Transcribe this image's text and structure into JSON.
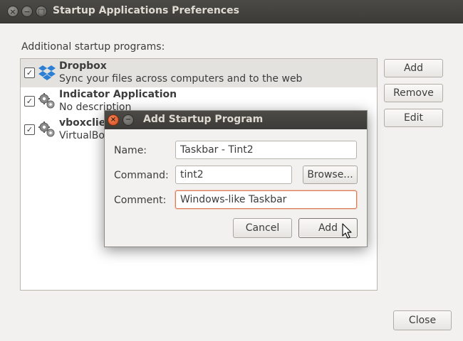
{
  "window": {
    "title": "Startup Applications Preferences",
    "close_glyph": "×",
    "min_glyph": "−",
    "max_glyph": "□"
  },
  "list_label": "Additional startup programs:",
  "programs": [
    {
      "name": "Dropbox",
      "description": "Sync your files across computers and to the web",
      "checked": true,
      "icon": "dropbox-icon"
    },
    {
      "name": "Indicator Application",
      "description": "No description",
      "checked": true,
      "icon": "gears-icon"
    },
    {
      "name": "vboxclient",
      "description": "VirtualBox",
      "checked": true,
      "icon": "gears-icon"
    }
  ],
  "side_buttons": {
    "add": "Add",
    "remove": "Remove",
    "edit": "Edit"
  },
  "close_button": "Close",
  "dialog": {
    "title": "Add Startup Program",
    "close_glyph": "×",
    "min_glyph": "−",
    "name_label": "Name:",
    "name_value": "Taskbar - Tint2",
    "command_label": "Command:",
    "command_value": "tint2",
    "browse_button": "Browse...",
    "comment_label": "Comment:",
    "comment_value": "Windows-like Taskbar",
    "cancel_button": "Cancel",
    "add_button": "Add"
  },
  "colors": {
    "titlebar": "#3c3b37",
    "focus_accent": "#e07a50",
    "close_button_active": "#d24a1b",
    "dropbox_blue": "#2d7fd6"
  }
}
